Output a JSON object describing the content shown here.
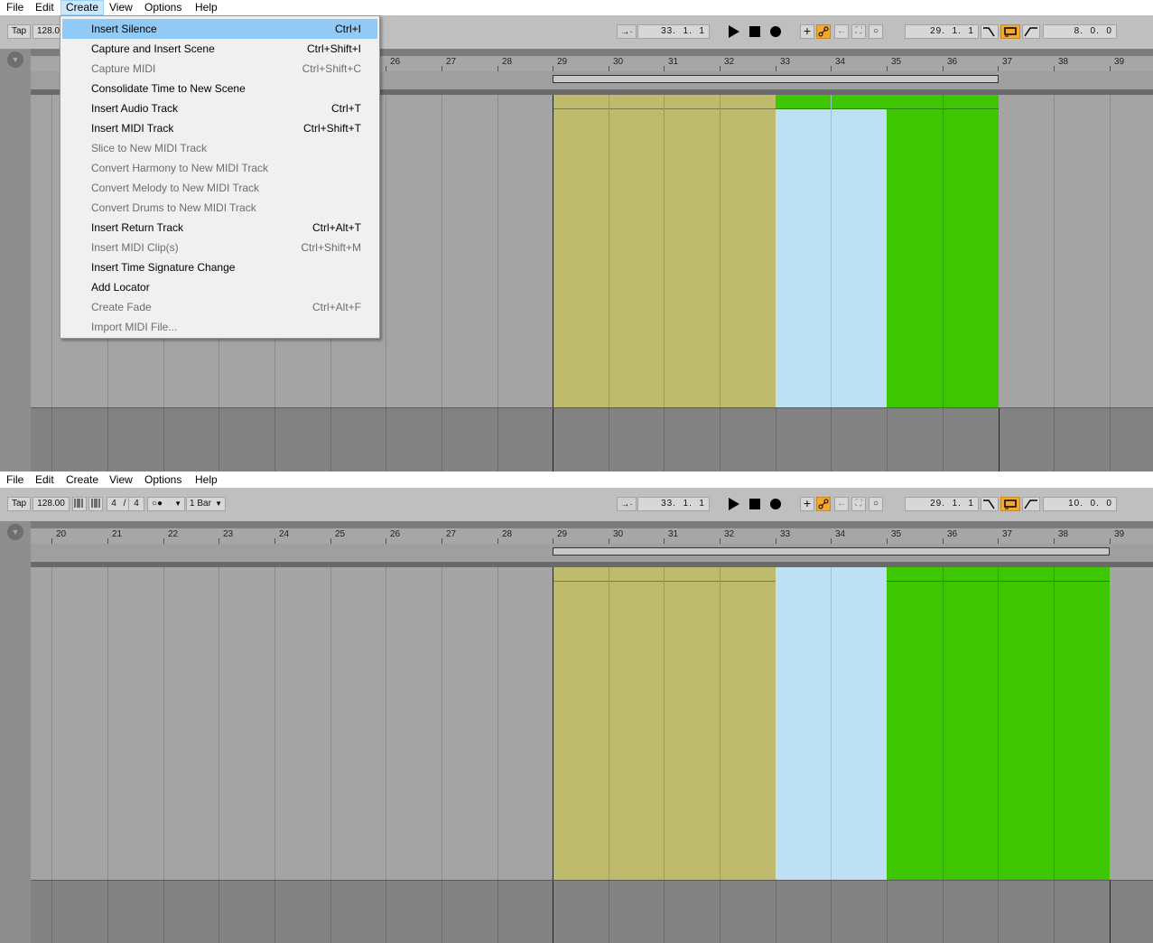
{
  "menubar": [
    "File",
    "Edit",
    "Create",
    "View",
    "Options",
    "Help"
  ],
  "create_menu": [
    {
      "label": "Insert Silence",
      "shortcut": "Ctrl+I",
      "enabled": true,
      "highlighted": true
    },
    {
      "label": "Capture and Insert Scene",
      "shortcut": "Ctrl+Shift+I",
      "enabled": true
    },
    {
      "label": "Capture MIDI",
      "shortcut": "Ctrl+Shift+C",
      "enabled": false
    },
    {
      "label": "Consolidate Time to New Scene",
      "shortcut": "",
      "enabled": true
    },
    {
      "label": "Insert Audio Track",
      "shortcut": "Ctrl+T",
      "enabled": true
    },
    {
      "label": "Insert MIDI Track",
      "shortcut": "Ctrl+Shift+T",
      "enabled": true
    },
    {
      "label": "Slice to New MIDI Track",
      "shortcut": "",
      "enabled": false
    },
    {
      "label": "Convert Harmony to New MIDI Track",
      "shortcut": "",
      "enabled": false
    },
    {
      "label": "Convert Melody to New MIDI Track",
      "shortcut": "",
      "enabled": false
    },
    {
      "label": "Convert Drums to New MIDI Track",
      "shortcut": "",
      "enabled": false
    },
    {
      "label": "Insert Return Track",
      "shortcut": "Ctrl+Alt+T",
      "enabled": true
    },
    {
      "label": "Insert MIDI Clip(s)",
      "shortcut": "Ctrl+Shift+M",
      "enabled": false
    },
    {
      "label": "Insert Time Signature Change",
      "shortcut": "",
      "enabled": true
    },
    {
      "label": "Add Locator",
      "shortcut": "",
      "enabled": true
    },
    {
      "label": "Create Fade",
      "shortcut": "Ctrl+Alt+F",
      "enabled": false
    },
    {
      "label": "Import MIDI File...",
      "shortcut": "",
      "enabled": false
    }
  ],
  "control_bar": {
    "tap": "Tap",
    "tempo": "128.00",
    "tempo_partial": "128.0",
    "time_sig_num": "4",
    "time_sig_sep": "/",
    "time_sig_den": "4",
    "metronome": "○●",
    "quantize": "1 Bar",
    "arrangement_position": "33.  1.  1",
    "loop_start": "29.  1.  1",
    "loop_length_top": "8.  0.  0",
    "loop_length_bottom": "10.  0.  0"
  },
  "ruler": {
    "top_bars": [
      "26",
      "27",
      "28",
      "29",
      "30",
      "31",
      "32",
      "33",
      "34",
      "35",
      "36",
      "37",
      "38",
      "39"
    ],
    "bottom_bars": [
      "20",
      "21",
      "22",
      "23",
      "24",
      "25",
      "26",
      "27",
      "28",
      "29",
      "30",
      "31",
      "32",
      "33",
      "34",
      "35",
      "36",
      "37",
      "38",
      "39"
    ]
  },
  "clips": {
    "colors": {
      "olive": "#bfbb6c",
      "light_blue": "#bde0f2",
      "green": "#3ec600"
    }
  },
  "colors": {
    "menu_highlight": "#91c9f7",
    "accent_orange": "#f3a832"
  }
}
